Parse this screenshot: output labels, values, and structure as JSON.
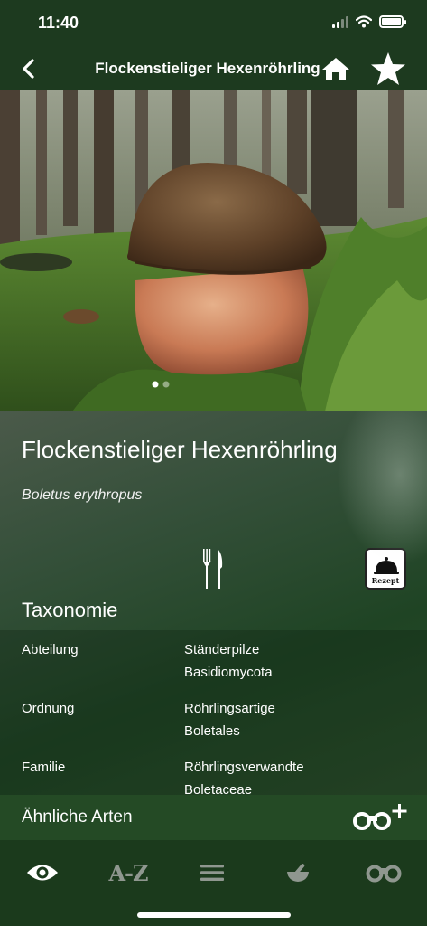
{
  "status": {
    "time": "11:40"
  },
  "nav": {
    "title": "Flockenstieliger Hexenröhrling",
    "back_icon": "chevron-left-icon",
    "home_icon": "home-icon",
    "favorite_icon": "star-icon"
  },
  "hero": {
    "page_count": 2,
    "current_page": 1
  },
  "species": {
    "name": "Flockenstieliger Hexenröhrling",
    "latin": "Boletus erythropus",
    "edibility_icon": "fork-knife-icon",
    "recipe_label": "Rezept"
  },
  "taxonomy": {
    "heading": "Taxonomie",
    "rows": [
      {
        "key": "Abteilung",
        "value": "Ständerpilze",
        "value_latin": "Basidiomycota"
      },
      {
        "key": "Ordnung",
        "value": "Röhrlingsartige",
        "value_latin": "Boletales"
      },
      {
        "key": "Familie",
        "value": "Röhrlingsverwandte",
        "value_latin": "Boletaceae"
      }
    ]
  },
  "similar": {
    "label": "Ähnliche Arten",
    "icon": "binoculars-plus-icon"
  },
  "tabs": [
    {
      "name": "view",
      "icon": "eye-icon",
      "active": true
    },
    {
      "name": "a-z",
      "label": "A-Z",
      "active": false
    },
    {
      "name": "list",
      "icon": "menu-icon",
      "active": false
    },
    {
      "name": "recipes",
      "icon": "mortar-icon",
      "active": false
    },
    {
      "name": "similar",
      "icon": "binoculars-icon",
      "active": false
    }
  ],
  "colors": {
    "header": "#1d3a1f",
    "tab_bar": "#1b3a1c",
    "tab_active": "#ffffff",
    "tab_inactive": "#8f978f"
  }
}
